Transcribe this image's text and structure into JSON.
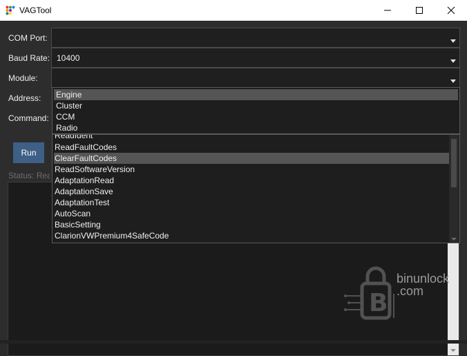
{
  "window": {
    "title": "VAGTool",
    "icon": "app-dots-icon",
    "controls": [
      "minimize-icon",
      "maximize-icon",
      "close-icon"
    ]
  },
  "form": {
    "com_port_label": "COM Port:",
    "com_port_value": "",
    "baud_rate_label": "Baud Rate:",
    "baud_rate_value": "10400",
    "module_label": "Module:",
    "module_value": "",
    "address_label": "Address:",
    "command_label": "Command:"
  },
  "module_dropdown": {
    "options": [
      "Engine",
      "Cluster",
      "CCM",
      "Radio"
    ],
    "highlighted": "Engine"
  },
  "command_dropdown": {
    "options": [
      "ReadIdent",
      "ReadFaultCodes",
      "ClearFaultCodes",
      "ReadSoftwareVersion",
      "AdaptationRead",
      "AdaptationSave",
      "AdaptationTest",
      "AutoScan",
      "BasicSetting",
      "ClarionVWPremium4SafeCode"
    ],
    "highlighted": "ClearFaultCodes"
  },
  "actions": {
    "run_label": "Run"
  },
  "status": {
    "text": "Status: Ready"
  },
  "watermark": {
    "line1": "binunlock",
    "line2": ".com"
  },
  "colors": {
    "accent": "#3e5f86",
    "background": "#2d2d2d",
    "highlight": "#555555"
  }
}
